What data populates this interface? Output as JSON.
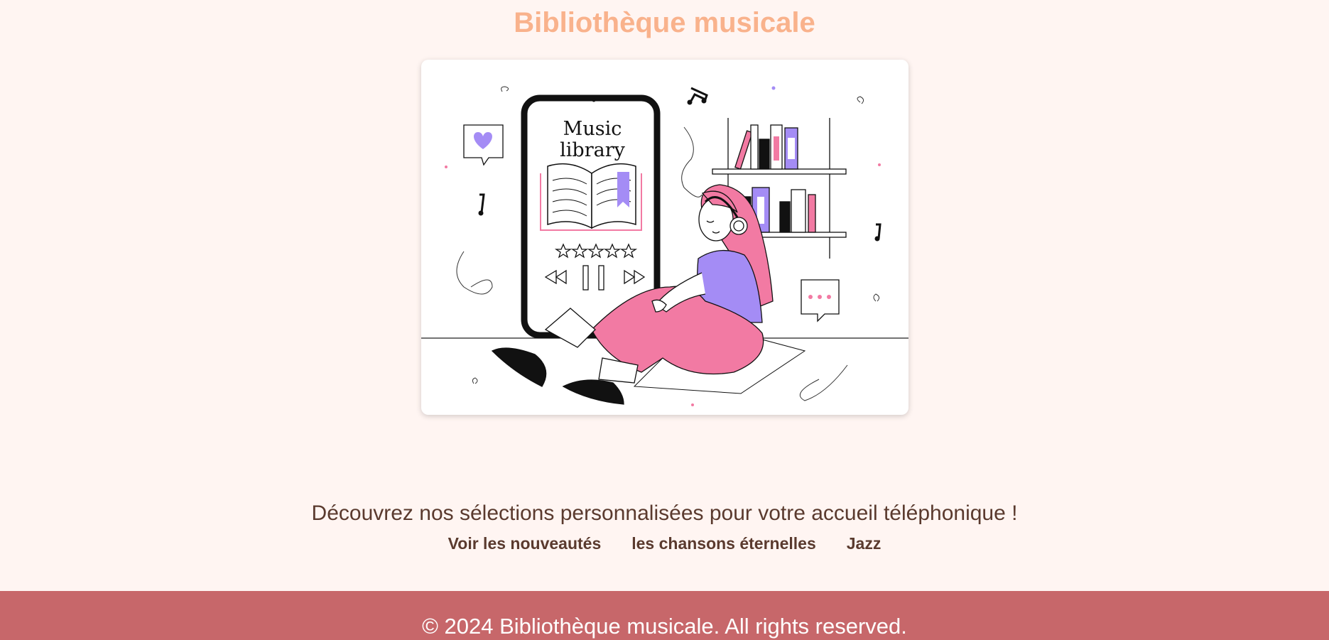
{
  "header": {
    "title": "Bibliothèque musicale"
  },
  "hero": {
    "image_text_line1": "Music",
    "image_text_line2": "library",
    "image_alt": "illustration-music-library",
    "colors": {
      "pink": "#f27aa3",
      "purple": "#a48cf5",
      "dark": "#111111"
    }
  },
  "main": {
    "tagline": "Découvrez nos sélections personnalisées pour votre accueil téléphonique !"
  },
  "nav": {
    "items": [
      {
        "label": "Voir les nouveautés"
      },
      {
        "label": "les chansons éternelles"
      },
      {
        "label": "Jazz"
      }
    ]
  },
  "footer": {
    "text": "© 2024 Bibliothèque musicale. All rights reserved."
  },
  "colors": {
    "background": "#fff5f2",
    "title": "#f9b28c",
    "text": "#5a3a2e",
    "footer_bg": "#c7676a",
    "footer_text": "#ffffff"
  }
}
